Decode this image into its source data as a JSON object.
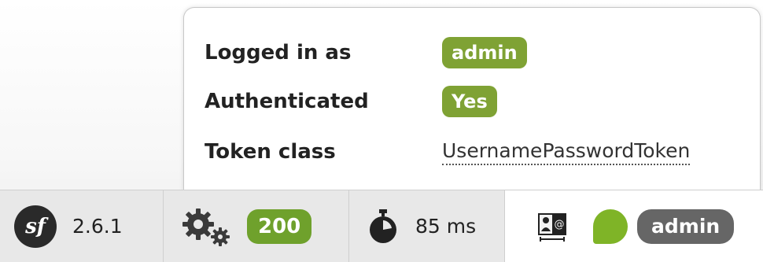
{
  "tooltip": {
    "rows": [
      {
        "label": "Logged in as",
        "value": "admin"
      },
      {
        "label": "Authenticated",
        "value": "Yes"
      },
      {
        "label": "Token class",
        "value": "UsernamePasswordToken"
      }
    ]
  },
  "toolbar": {
    "version": "2.6.1",
    "status_code": "200",
    "time": "85 ms",
    "user": "admin",
    "logo_glyph": "sf"
  },
  "colors": {
    "accent_green": "#7fa234",
    "status_green": "#6fa12c",
    "user_badge_gray": "#666666"
  },
  "icons": [
    "symfony-logo-icon",
    "gears-icon",
    "stopwatch-icon",
    "user-card-icon",
    "status-dot-icon"
  ]
}
